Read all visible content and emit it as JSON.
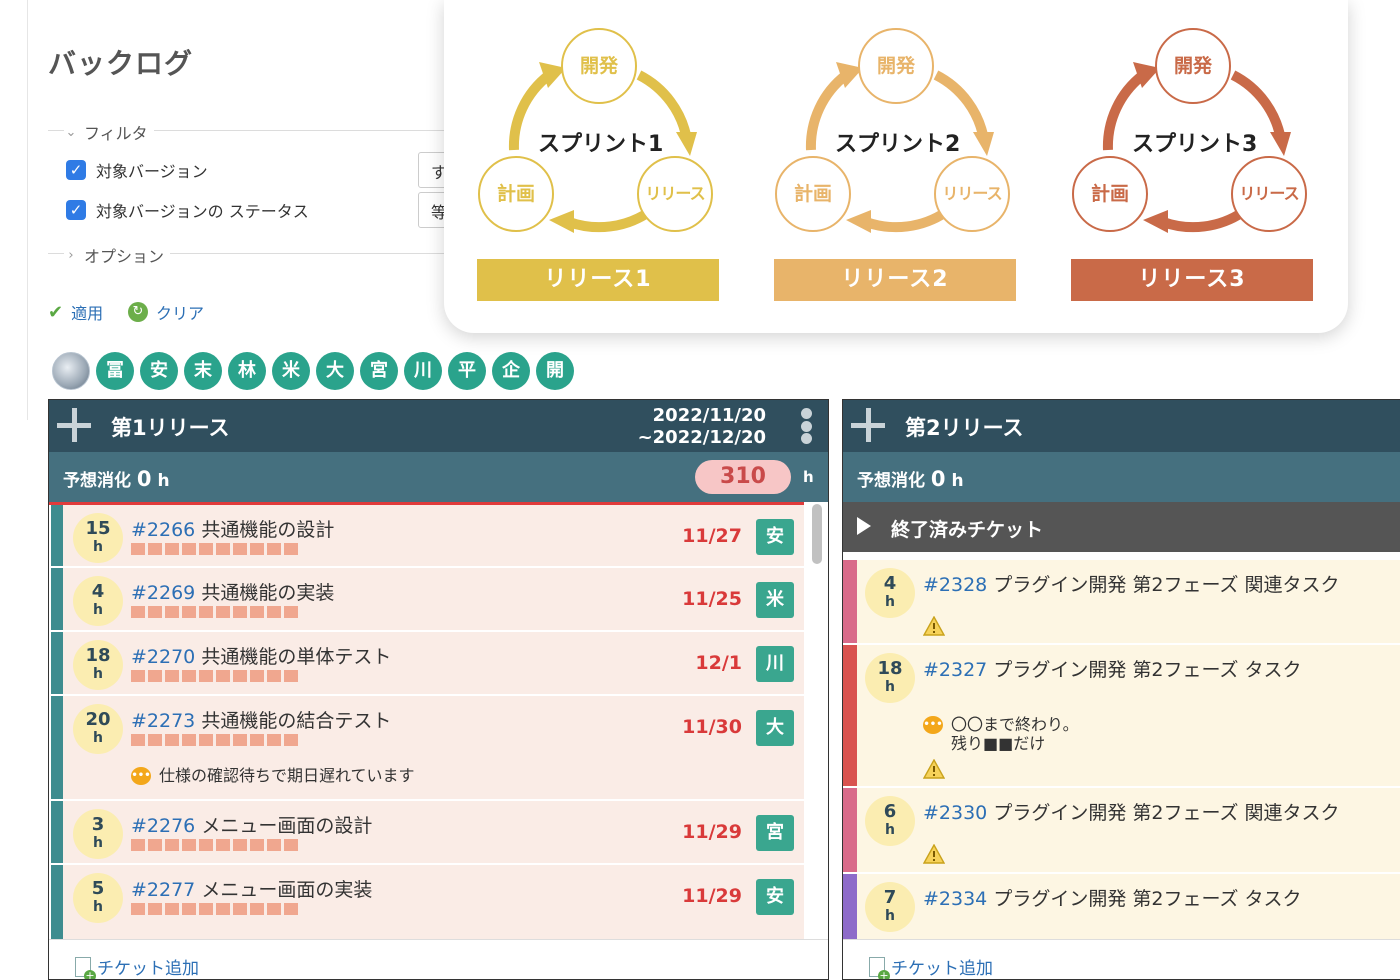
{
  "page": {
    "title": "バックログ"
  },
  "filter": {
    "legend": "フィルタ",
    "rows": [
      {
        "label": "対象バージョン",
        "select_value": "す"
      },
      {
        "label": "対象バージョンの ステータス",
        "select_value": "等"
      }
    ],
    "options_legend": "オプション",
    "apply_label": "適用",
    "clear_label": "クリア"
  },
  "members": [
    "冨",
    "安",
    "末",
    "林",
    "米",
    "大",
    "宮",
    "川",
    "平",
    "企",
    "開"
  ],
  "releases": [
    {
      "title": "第1リリース",
      "date_start": "2022/11/20",
      "date_end": "~2022/12/20",
      "estimate_label": "予想消化",
      "estimate_value": "0",
      "estimate_unit": "h",
      "capacity": "310",
      "capacity_unit": "h",
      "add_ticket_label": "チケット追加",
      "tickets": [
        {
          "hours": "15",
          "unit": "h",
          "id": "#2266",
          "title": "共通機能の設計",
          "due": "11/27",
          "assignee": "安"
        },
        {
          "hours": "4",
          "unit": "h",
          "id": "#2269",
          "title": "共通機能の実装",
          "due": "11/25",
          "assignee": "米"
        },
        {
          "hours": "18",
          "unit": "h",
          "id": "#2270",
          "title": "共通機能の単体テスト",
          "due": "12/1",
          "assignee": "川"
        },
        {
          "hours": "20",
          "unit": "h",
          "id": "#2273",
          "title": "共通機能の結合テスト",
          "due": "11/30",
          "assignee": "大",
          "comment": "仕様の確認待ちで期日遅れています"
        },
        {
          "hours": "3",
          "unit": "h",
          "id": "#2276",
          "title": "メニュー画面の設計",
          "due": "11/29",
          "assignee": "宮"
        },
        {
          "hours": "5",
          "unit": "h",
          "id": "#2277",
          "title": "メニュー画面の実装",
          "due": "11/29",
          "assignee": "安"
        }
      ]
    },
    {
      "title": "第2リリース",
      "estimate_label": "予想消化",
      "estimate_value": "0",
      "estimate_unit": "h",
      "closed_label": "終了済みチケット",
      "add_ticket_label": "チケット追加",
      "tickets": [
        {
          "hours": "4",
          "unit": "h",
          "id": "#2328",
          "title": "プラグイン開発 第2フェーズ 関連タスク",
          "bar_color": "#d96b8a"
        },
        {
          "hours": "18",
          "unit": "h",
          "id": "#2327",
          "title": "プラグイン開発 第2フェーズ タスク",
          "comment_line1": "〇〇まで終わり。",
          "comment_line2": "残り■■だけ",
          "bar_color": "#d9534f"
        },
        {
          "hours": "6",
          "unit": "h",
          "id": "#2330",
          "title": "プラグイン開発 第2フェーズ 関連タスク",
          "bar_color": "#d96b8a"
        },
        {
          "hours": "7",
          "unit": "h",
          "id": "#2334",
          "title": "プラグイン開発 第2フェーズ タスク",
          "bar_color": "#8e6bc9"
        }
      ]
    }
  ],
  "overlay": {
    "cycles": [
      {
        "sprint": "スプリント1",
        "dev": "開発",
        "release_node": "リリース",
        "plan": "計画",
        "release_bar": "リリース1",
        "color": "#e0c04a"
      },
      {
        "sprint": "スプリント2",
        "dev": "開発",
        "release_node": "リリース",
        "plan": "計画",
        "release_bar": "リリース2",
        "color": "#e8b46a"
      },
      {
        "sprint": "スプリント3",
        "dev": "開発",
        "release_node": "リリース",
        "plan": "計画",
        "release_bar": "リリース3",
        "color": "#c96a48"
      }
    ]
  },
  "colors": {
    "header_dark": "#304f5e",
    "header_sub": "#45707f",
    "assignee_green": "#3aa68f",
    "due_red": "#d93a3a",
    "link_blue": "#2c6fb5"
  }
}
